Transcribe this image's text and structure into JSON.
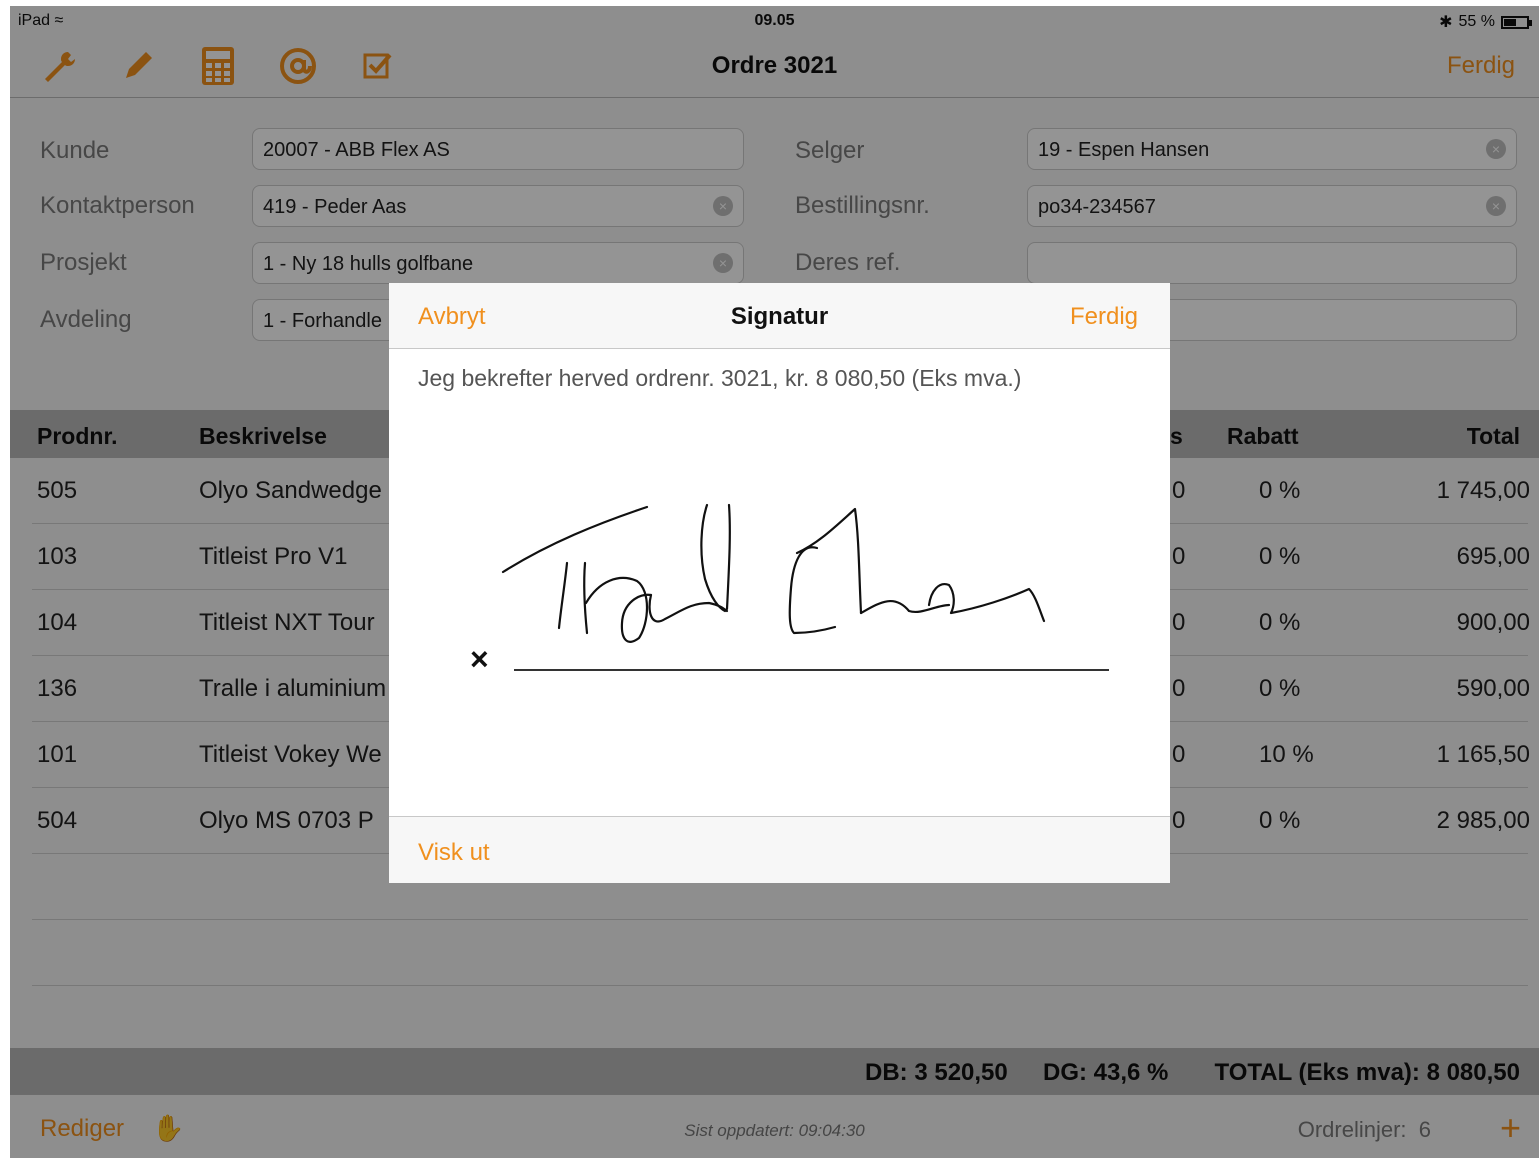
{
  "status_bar": {
    "device": "iPad",
    "time": "09.05",
    "battery": "55 %",
    "battery_level": 0.55
  },
  "nav": {
    "title": "Ordre 3021",
    "done_label": "Ferdig",
    "icons": [
      "wrench-icon",
      "pencil-icon",
      "calculator-icon",
      "at-icon",
      "checkbox-icon"
    ]
  },
  "form": {
    "kunde_label": "Kunde",
    "kunde_value": "20007 - ABB Flex AS",
    "kontakt_label": "Kontaktperson",
    "kontakt_value": "419 - Peder Aas",
    "prosjekt_label": "Prosjekt",
    "prosjekt_value": "1 - Ny 18 hulls golfbane",
    "avdeling_label": "Avdeling",
    "avdeling_value": "1 - Forhandle",
    "selger_label": "Selger",
    "selger_value": "19 - Espen Hansen",
    "bestilling_label": "Bestillingsnr.",
    "bestilling_value": "po34-234567",
    "deres_label": "Deres ref.",
    "deres_value": ""
  },
  "table": {
    "headers": {
      "prodnr": "Prodnr.",
      "beskrivelse": "Beskrivelse",
      "hidden_tail": "s",
      "rabatt": "Rabatt",
      "total": "Total"
    },
    "rows": [
      {
        "prodnr": "505",
        "beskrivelse": "Olyo Sandwedge",
        "hidden_tail": "0",
        "rabatt": "0 %",
        "total": "1 745,00"
      },
      {
        "prodnr": "103",
        "beskrivelse": "Titleist Pro V1",
        "hidden_tail": "0",
        "rabatt": "0 %",
        "total": "695,00"
      },
      {
        "prodnr": "104",
        "beskrivelse": "Titleist NXT Tour",
        "hidden_tail": "0",
        "rabatt": "0 %",
        "total": "900,00"
      },
      {
        "prodnr": "136",
        "beskrivelse": "Tralle i aluminium",
        "hidden_tail": "0",
        "rabatt": "0 %",
        "total": "590,00"
      },
      {
        "prodnr": "101",
        "beskrivelse": "Titleist Vokey We",
        "hidden_tail": "0",
        "rabatt": "10 %",
        "total": "1 165,50"
      },
      {
        "prodnr": "504",
        "beskrivelse": "Olyo MS 0703 P",
        "hidden_tail": "0",
        "rabatt": "0 %",
        "total": "2 985,00"
      }
    ]
  },
  "summary": {
    "db": "DB: 3 520,50",
    "dg": "DG: 43,6 %",
    "total": "TOTAL (Eks mva): 8 080,50"
  },
  "toolbar": {
    "edit_label": "Rediger",
    "updated": "Sist oppdatert: 09:04:30",
    "lines_label": "Ordrelinjer:",
    "lines_count": "6"
  },
  "modal": {
    "cancel_label": "Avbryt",
    "title": "Signatur",
    "done_label": "Ferdig",
    "confirm_text": "Jeg bekrefter herved ordrenr. 3021, kr. 8 080,50 (Eks mva.)",
    "x_mark": "×",
    "clear_label": "Visk ut"
  },
  "colors": {
    "accent": "#f0901e",
    "header_gray": "#b8b8b8",
    "overlay": "rgba(0,0,0,0.42)"
  }
}
